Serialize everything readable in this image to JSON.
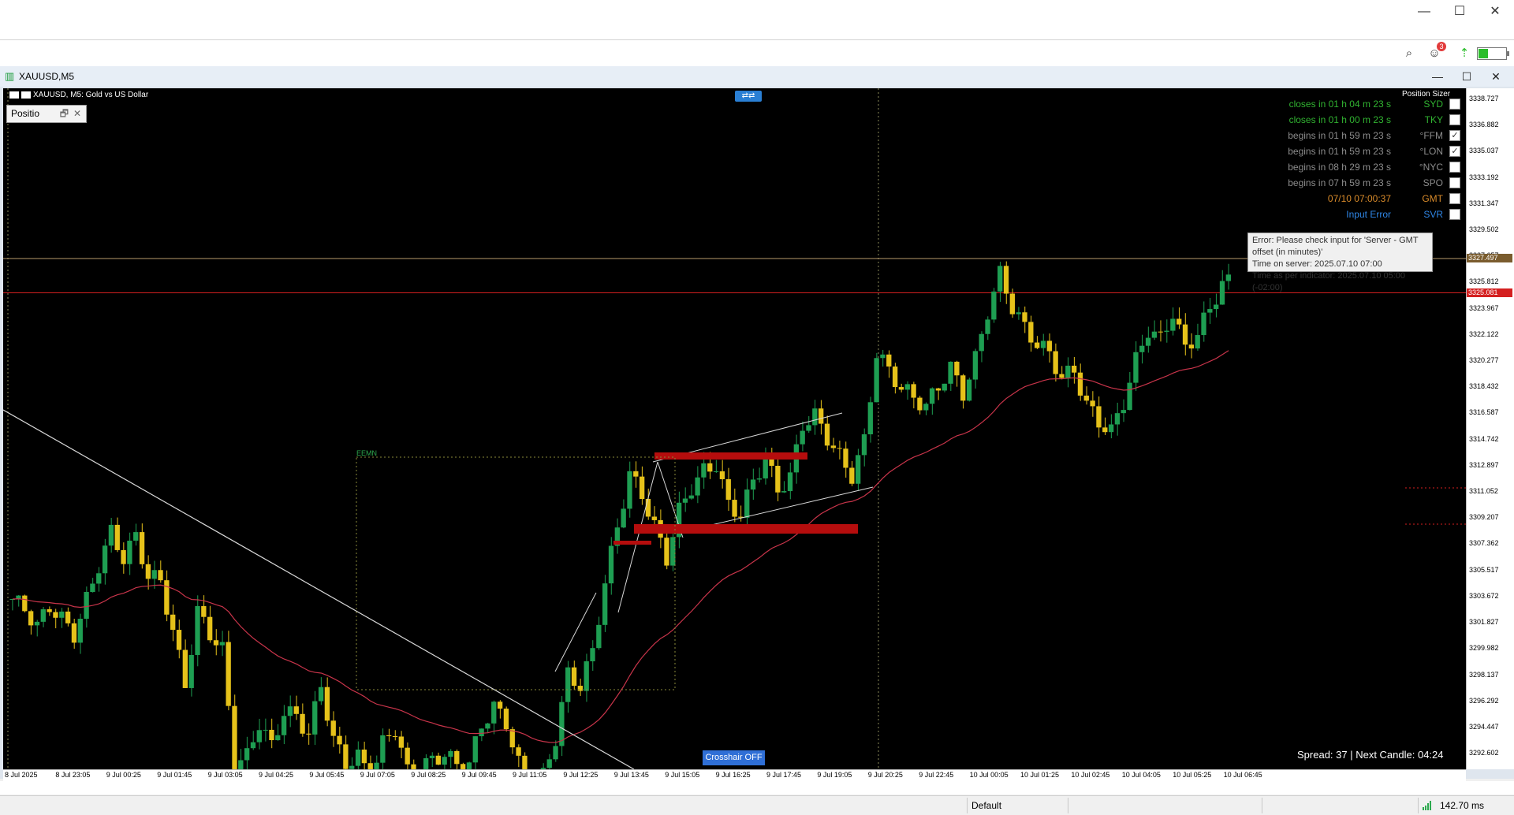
{
  "window": {
    "minimize": "—",
    "maximize": "☐",
    "close": "✕"
  },
  "toolbar": {
    "notification_count": "3",
    "battery_level": 0.35
  },
  "chart_window": {
    "title": "XAUUSD,M5",
    "minimize": "—",
    "maximize": "☐",
    "close": "✕"
  },
  "chart_header": {
    "symbol_info": "XAUUSD, M5:  Gold vs US Dollar"
  },
  "position_panel": {
    "label": "Positio",
    "restore": "🗗",
    "close": "✕"
  },
  "position_sizer": {
    "label": "Position Sizer"
  },
  "sessions": [
    {
      "time": "closes in 01 h 04 m 23 s",
      "name": "SYD",
      "checked": false,
      "color": "#31b331"
    },
    {
      "time": "closes in 01 h 00 m 23 s",
      "name": "TKY",
      "checked": false,
      "color": "#31b331"
    },
    {
      "time": "begins in 01 h 59 m 23 s",
      "name": "°FFM",
      "checked": true,
      "color": "#8c8c8c"
    },
    {
      "time": "begins in 01 h 59 m 23 s",
      "name": "°LON",
      "checked": true,
      "color": "#8c8c8c"
    },
    {
      "time": "begins in 08 h 29 m 23 s",
      "name": "°NYC",
      "checked": false,
      "color": "#8c8c8c"
    },
    {
      "time": "begins in 07 h 59 m 23 s",
      "name": "SPO",
      "checked": false,
      "color": "#8c8c8c"
    },
    {
      "time": "07/10 07:00:37",
      "name": "GMT",
      "checked": false,
      "color": "#d88a2a"
    },
    {
      "time": "Input Error",
      "name": "SVR",
      "checked": false,
      "color": "#2f86e6"
    }
  ],
  "tooltip": {
    "line1": "Error: Please check input for 'Server - GMT offset (in minutes)'",
    "line2": "Time on server: 2025.07.10 07:00",
    "line3": "Time as per indicator: 2025.07.10 05:00 (-02:00)"
  },
  "spread_text": "Spread: 37 | Next Candle: 04:24",
  "crosshair_button": "Crosshair OFF",
  "zone_label": "EEMN",
  "price_axis": {
    "ticks": [
      "3338.727",
      "3336.882",
      "3335.037",
      "3333.192",
      "3331.347",
      "3329.502",
      "3327.657",
      "3325.812",
      "3323.967",
      "3322.122",
      "3320.277",
      "3318.432",
      "3316.587",
      "3314.742",
      "3312.897",
      "3311.052",
      "3309.207",
      "3307.362",
      "3305.517",
      "3303.672",
      "3301.827",
      "3299.982",
      "3298.137",
      "3296.292",
      "3294.447",
      "3292.602"
    ],
    "ask_tag": "3327.497",
    "bid_tag": "3325.081"
  },
  "time_axis": {
    "ticks": [
      "8 Jul 2025",
      "8 Jul 23:05",
      "9 Jul 00:25",
      "9 Jul 01:45",
      "9 Jul 03:05",
      "9 Jul 04:25",
      "9 Jul 05:45",
      "9 Jul 07:05",
      "9 Jul 08:25",
      "9 Jul 09:45",
      "9 Jul 11:05",
      "9 Jul 12:25",
      "9 Jul 13:45",
      "9 Jul 15:05",
      "9 Jul 16:25",
      "9 Jul 17:45",
      "9 Jul 19:05",
      "9 Jul 20:25",
      "9 Jul 22:45",
      "10 Jul 00:05",
      "10 Jul 01:25",
      "10 Jul 02:45",
      "10 Jul 04:05",
      "10 Jul 05:25",
      "10 Jul 06:45"
    ]
  },
  "statusbar": {
    "profile": "Default",
    "ping": "142.70 ms"
  },
  "chart_data": {
    "type": "candlestick",
    "symbol": "XAUUSD",
    "timeframe": "M5",
    "ylim": [
      3291.5,
      3339.5
    ],
    "bid": 3325.081,
    "ask": 3327.497,
    "close_series": [
      3303.5,
      3302.8,
      3301.6,
      3303.0,
      3302.1,
      3301.0,
      3303.4,
      3305.9,
      3308.2,
      3306.4,
      3307.9,
      3305.1,
      3304.8,
      3301.2,
      3297.5,
      3302.6,
      3301.1,
      3299.9,
      3291.8,
      3292.4,
      3294.8,
      3293.1,
      3295.6,
      3295.2,
      3294.0,
      3297.4,
      3293.6,
      3291.9,
      3292.4,
      3290.9,
      3293.3,
      3294.4,
      3291.3,
      3291.6,
      3292.1,
      3292.6,
      3291.8,
      3291.9,
      3294.6,
      3295.9,
      3294.8,
      3291.9,
      3289.8,
      3291.0,
      3293.7,
      3298.2,
      3297.4,
      3299.8,
      3304.7,
      3308.6,
      3312.3,
      3310.9,
      3308.6,
      3306.4,
      3309.7,
      3311.4,
      3312.5,
      3313.0,
      3310.1,
      3309.5,
      3311.8,
      3313.4,
      3311.2,
      3312.1,
      3315.8,
      3316.4,
      3314.9,
      3313.5,
      3312.2,
      3314.6,
      3320.9,
      3319.6,
      3318.4,
      3317.7,
      3317.1,
      3318.5,
      3319.8,
      3318.0,
      3320.4,
      3323.8,
      3326.4,
      3324.1,
      3322.6,
      3321.5,
      3320.8,
      3319.1,
      3319.6,
      3317.2,
      3316.0,
      3315.3,
      3317.4,
      3320.3,
      3322.5,
      3321.8,
      3323.7,
      3321.1,
      3322.3,
      3323.9,
      3325.8
    ]
  }
}
